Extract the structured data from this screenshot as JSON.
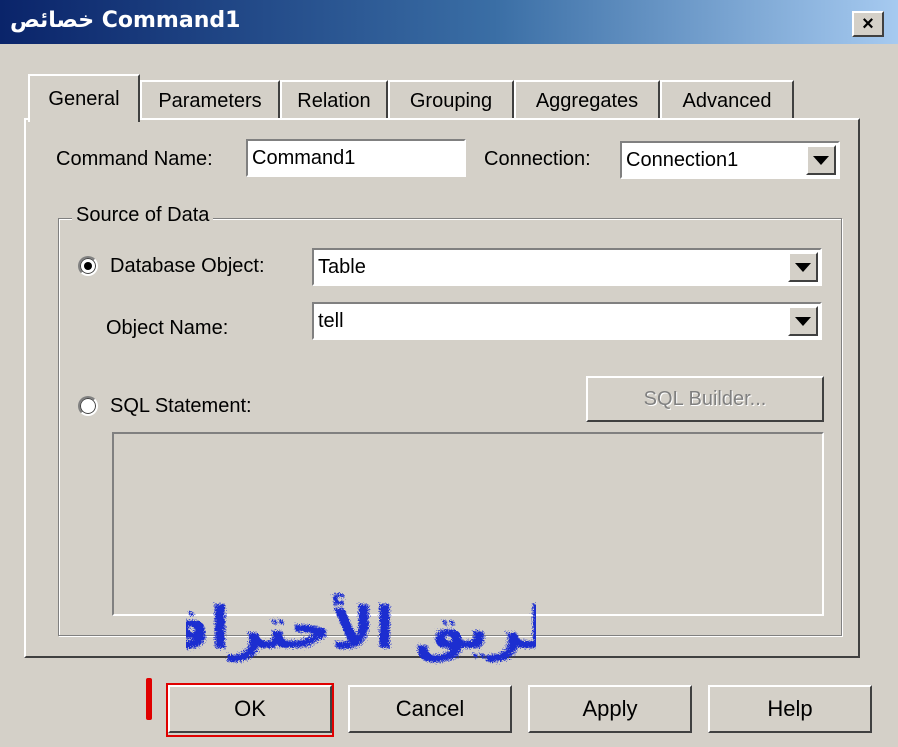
{
  "window": {
    "title": "خصائص Command1",
    "close_label": "×"
  },
  "tabs": [
    {
      "label": "General",
      "active": true
    },
    {
      "label": "Parameters",
      "active": false
    },
    {
      "label": "Relation",
      "active": false
    },
    {
      "label": "Grouping",
      "active": false
    },
    {
      "label": "Aggregates",
      "active": false
    },
    {
      "label": "Advanced",
      "active": false
    }
  ],
  "general": {
    "command_name_label": "Command Name:",
    "command_name_value": "Command1",
    "connection_label": "Connection:",
    "connection_value": "Connection1",
    "source_group_title": "Source of Data",
    "database_object_label": "Database Object:",
    "database_object_value": "Table",
    "database_object_selected": true,
    "object_name_label": "Object Name:",
    "object_name_value": "tell",
    "sql_statement_label": "SQL Statement:",
    "sql_statement_selected": false,
    "sql_builder_label": "SQL Builder...",
    "sql_text": ""
  },
  "buttons": {
    "ok": "OK",
    "cancel": "Cancel",
    "apply": "Apply",
    "help": "Help"
  },
  "annotation": {
    "marker_text": "",
    "highlight_color": "#e00000"
  },
  "watermark": {
    "text": "طريق الأحتراف",
    "color": "#1a2fd0"
  },
  "colors": {
    "title_gradient_start": "#0a246a",
    "title_gradient_end": "#a6caf0",
    "face": "#d4d0c8"
  }
}
